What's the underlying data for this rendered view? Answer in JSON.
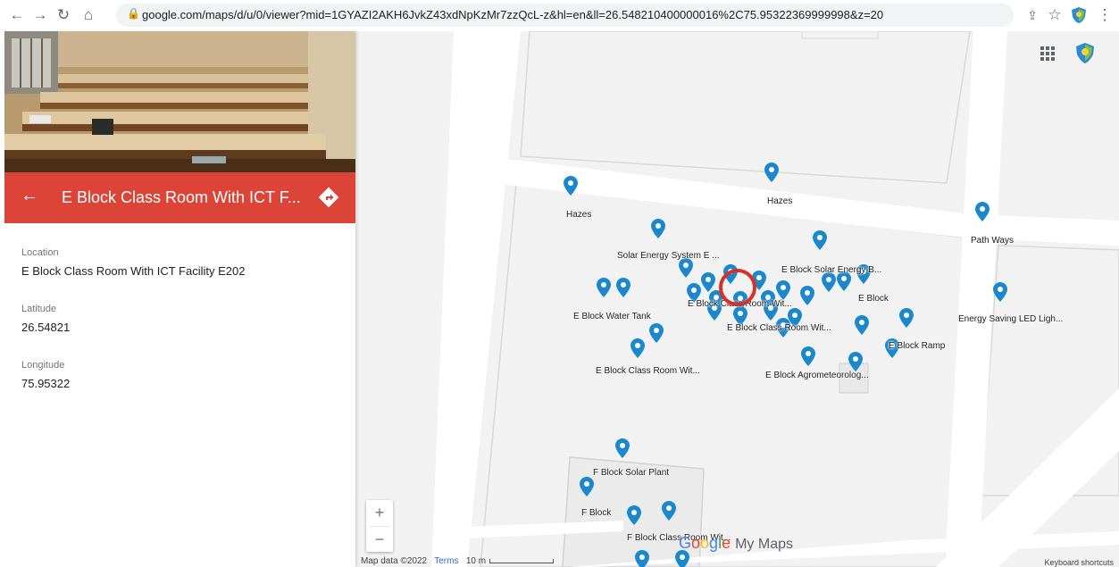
{
  "browser": {
    "url": "google.com/maps/d/u/0/viewer?mid=1GYAZI2AKH6JvkZ43xdNpKzMr7zzQcL-z&hl=en&ll=26.548210400000016%2C75.95322369999998&z=20"
  },
  "panel": {
    "title": "E Block Class Room With ICT F...",
    "fields": [
      {
        "label": "Location",
        "value": "E Block Class Room With ICT Facility E202"
      },
      {
        "label": "Latitude",
        "value": "26.54821"
      },
      {
        "label": "Longitude",
        "value": "75.95322"
      }
    ]
  },
  "map": {
    "pin_color": "#1b88cc",
    "highlight_color": "#d93025",
    "labels": [
      "Hazes",
      "Hazes",
      "Path Ways",
      "Solar Energy System E ...",
      "E Block Solar Energy B...",
      "E Block",
      "E Block Water Tank",
      "E Block Class Room Wit...",
      "E Block Class Room Wit...",
      "Energy Saving LED Ligh...",
      "E Block Ramp",
      "E Block Class Room Wit...",
      "E Block Agrometeorolog...",
      "F Block Solar Plant",
      "F Block",
      "F Block Class Room Wit..."
    ],
    "zoom_in": "+",
    "zoom_out": "−",
    "map_data": "Map data ©2022",
    "terms": "Terms",
    "scale": "10 m",
    "brand_suffix": "My Maps",
    "keyboard": "Keyboard shortcuts"
  }
}
